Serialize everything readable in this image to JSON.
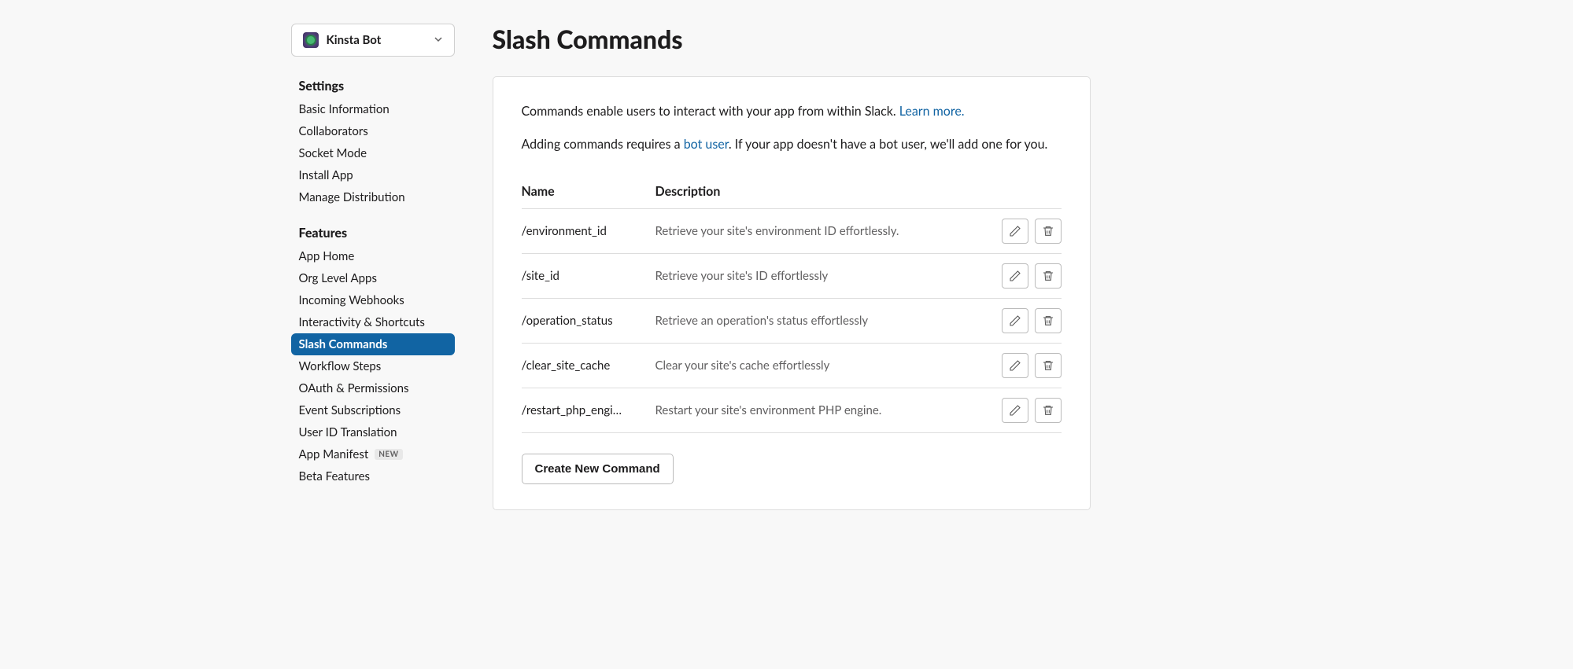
{
  "app_selector": {
    "name": "Kinsta Bot"
  },
  "sidebar": {
    "settings_heading": "Settings",
    "settings_items": [
      "Basic Information",
      "Collaborators",
      "Socket Mode",
      "Install App",
      "Manage Distribution"
    ],
    "features_heading": "Features",
    "features_items": [
      "App Home",
      "Org Level Apps",
      "Incoming Webhooks",
      "Interactivity & Shortcuts",
      "Slash Commands",
      "Workflow Steps",
      "OAuth & Permissions",
      "Event Subscriptions",
      "User ID Translation",
      "App Manifest",
      "Beta Features"
    ],
    "active_feature": "Slash Commands",
    "manifest_badge": "NEW"
  },
  "page": {
    "title": "Slash Commands",
    "intro_text_1": "Commands enable users to interact with your app from within Slack. ",
    "learn_more": "Learn more.",
    "intro_text_2a": "Adding commands requires a ",
    "bot_user_link": "bot user",
    "intro_text_2b": ". If your app doesn't have a bot user, we'll add one for you.",
    "table": {
      "col_name": "Name",
      "col_desc": "Description"
    },
    "commands": [
      {
        "name": "/environment_id",
        "desc": "Retrieve your site's environment ID effortlessly."
      },
      {
        "name": "/site_id",
        "desc": "Retrieve your site's ID effortlessly"
      },
      {
        "name": "/operation_status",
        "desc": "Retrieve an operation's status effortlessly"
      },
      {
        "name": "/clear_site_cache",
        "desc": "Clear your site's cache effortlessly"
      },
      {
        "name": "/restart_php_engi…",
        "desc": "Restart your site's environment PHP engine."
      }
    ],
    "create_button": "Create New Command"
  }
}
